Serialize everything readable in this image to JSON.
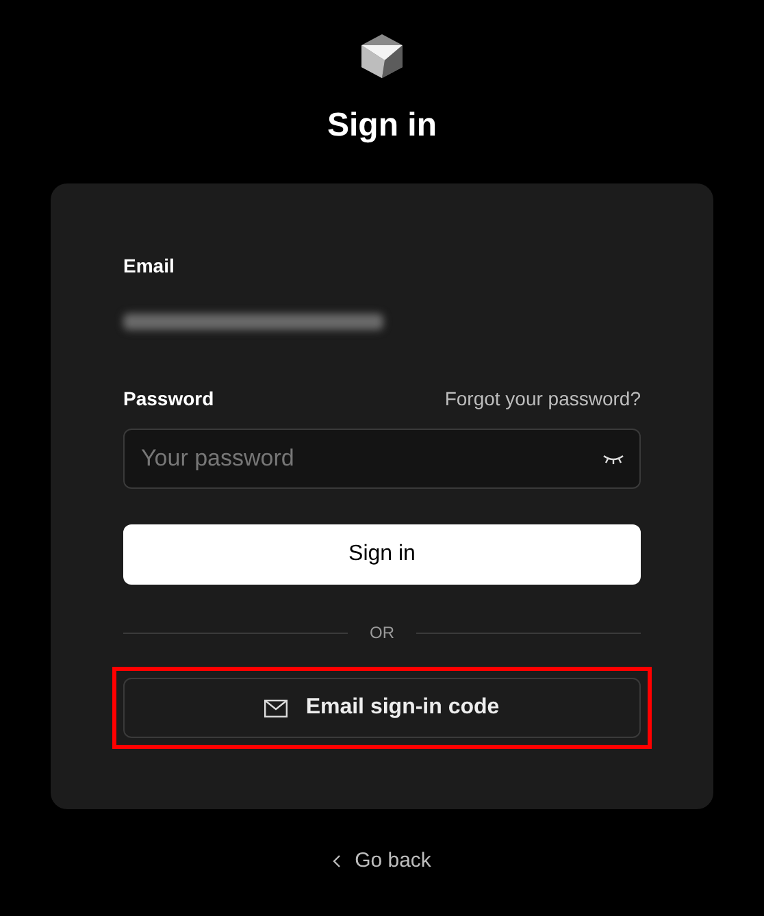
{
  "title": "Sign in",
  "email": {
    "label": "Email",
    "redacted": true
  },
  "password": {
    "label": "Password",
    "forgot_link": "Forgot your password?",
    "placeholder": "Your password"
  },
  "sign_in_button": "Sign in",
  "divider": "OR",
  "code_button": {
    "label": "Email sign-in code",
    "highlighted": true
  },
  "back_link": "Go back"
}
